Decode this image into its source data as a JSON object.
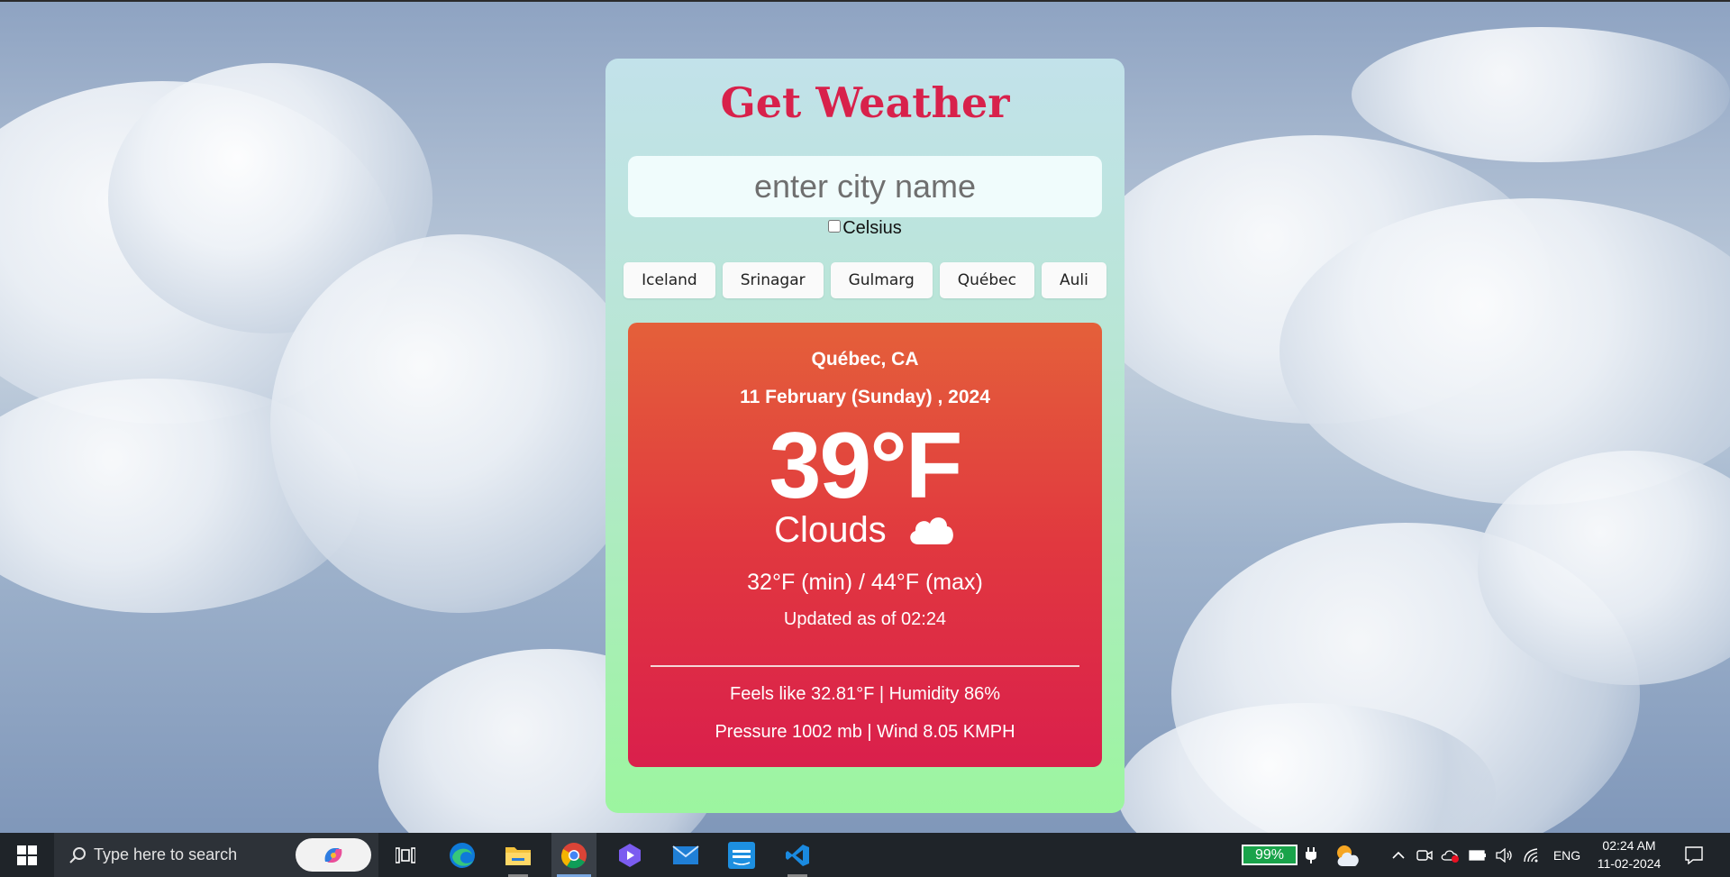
{
  "app": {
    "title": "Get Weather",
    "search": {
      "placeholder": "enter city name",
      "value": ""
    },
    "unit_toggle": {
      "label": "Celsius",
      "checked": false
    },
    "quick_cities": [
      "Iceland",
      "Srinagar",
      "Gulmarg",
      "Québec",
      "Auli"
    ]
  },
  "weather": {
    "location": "Québec, CA",
    "date": "11 February (Sunday) , 2024",
    "temperature": "39°F",
    "condition": "Clouds",
    "condition_icon": "cloud-icon",
    "range": "32°F (min) / 44°F (max)",
    "updated": "Updated as of 02:24",
    "feels_humidity": "Feels like 32.81°F | Humidity 86%",
    "pressure_wind": "Pressure 1002 mb | Wind 8.05 KMPH"
  },
  "taskbar": {
    "search_placeholder": "Type here to search",
    "battery": "99%",
    "language": "ENG",
    "time": "02:24 AM",
    "date": "11-02-2024",
    "apps": [
      "task-view-icon",
      "edge-icon",
      "file-explorer-icon",
      "chrome-icon",
      "clipchamp-icon",
      "mail-icon",
      "prime-video-icon",
      "vscode-icon"
    ]
  },
  "colors": {
    "title": "#d8214b",
    "card_top": "#c2e2ea",
    "card_bottom": "#9cf59f",
    "result_top": "#e4603a",
    "result_bottom": "#da1f4c"
  }
}
